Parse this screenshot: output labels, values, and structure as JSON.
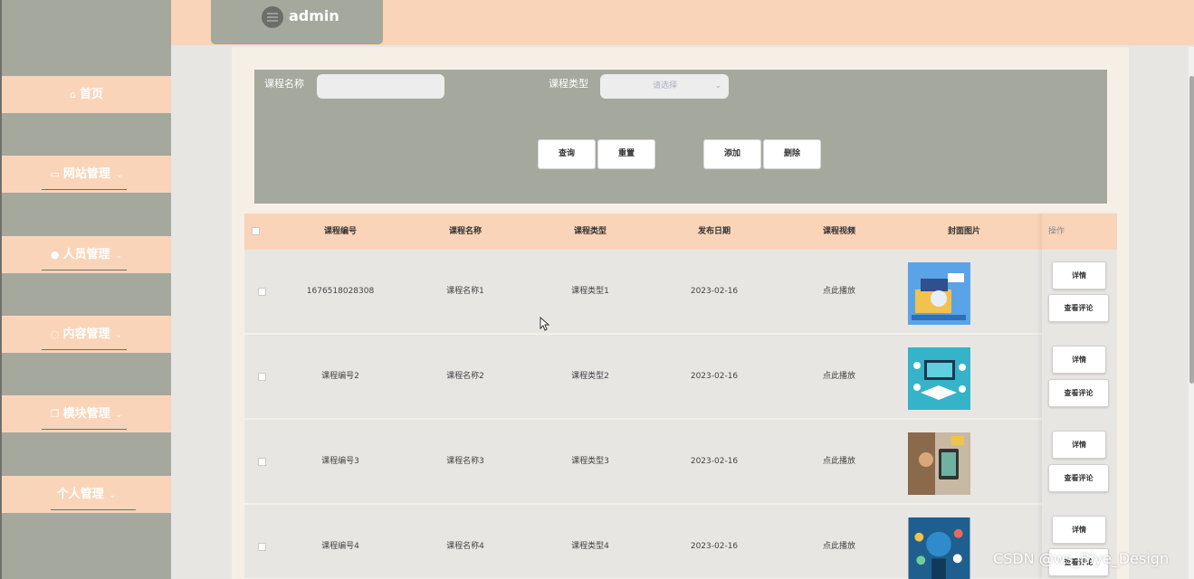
{
  "header": {
    "username": "admin"
  },
  "sidebar": {
    "items": [
      {
        "label": "首页",
        "icon": "home-icon",
        "has_chevron": false
      },
      {
        "label": "网站管理",
        "icon": "monitor-icon",
        "has_chevron": true
      },
      {
        "label": "人员管理",
        "icon": "user-icon",
        "has_chevron": true
      },
      {
        "label": "内容管理",
        "icon": "message-icon",
        "has_chevron": true
      },
      {
        "label": "模块管理",
        "icon": "copy-icon",
        "has_chevron": true
      },
      {
        "label": "个人管理",
        "icon": "",
        "has_chevron": true
      }
    ]
  },
  "search": {
    "course_name_label": "课程名称",
    "course_name_value": "",
    "course_type_label": "课程类型",
    "course_type_placeholder": "请选择",
    "query_label": "查询",
    "reset_label": "重置",
    "add_label": "添加",
    "delete_label": "删除"
  },
  "table": {
    "headers": [
      "课程编号",
      "课程名称",
      "课程类型",
      "发布日期",
      "课程视频",
      "封面图片",
      "操作"
    ],
    "rows": [
      {
        "code": "1676518028308",
        "name": "课程名称1",
        "type": "课程类型1",
        "date": "2023-02-16",
        "video": "点此播放"
      },
      {
        "code": "课程编号2",
        "name": "课程名称2",
        "type": "课程类型2",
        "date": "2023-02-16",
        "video": "点此播放"
      },
      {
        "code": "课程编号3",
        "name": "课程名称3",
        "type": "课程类型3",
        "date": "2023-02-16",
        "video": "点此播放"
      },
      {
        "code": "课程编号4",
        "name": "课程名称4",
        "type": "课程类型4",
        "date": "2023-02-16",
        "video": "点此播放"
      }
    ],
    "detail_label": "详情",
    "comments_label": "查看评论"
  },
  "colors": {
    "sidebar_bg": "#a5a89c",
    "accent_peach": "#fad4b8",
    "main_bg": "#f5efe6"
  },
  "watermark": "CSDN @ws_Biye_Design"
}
